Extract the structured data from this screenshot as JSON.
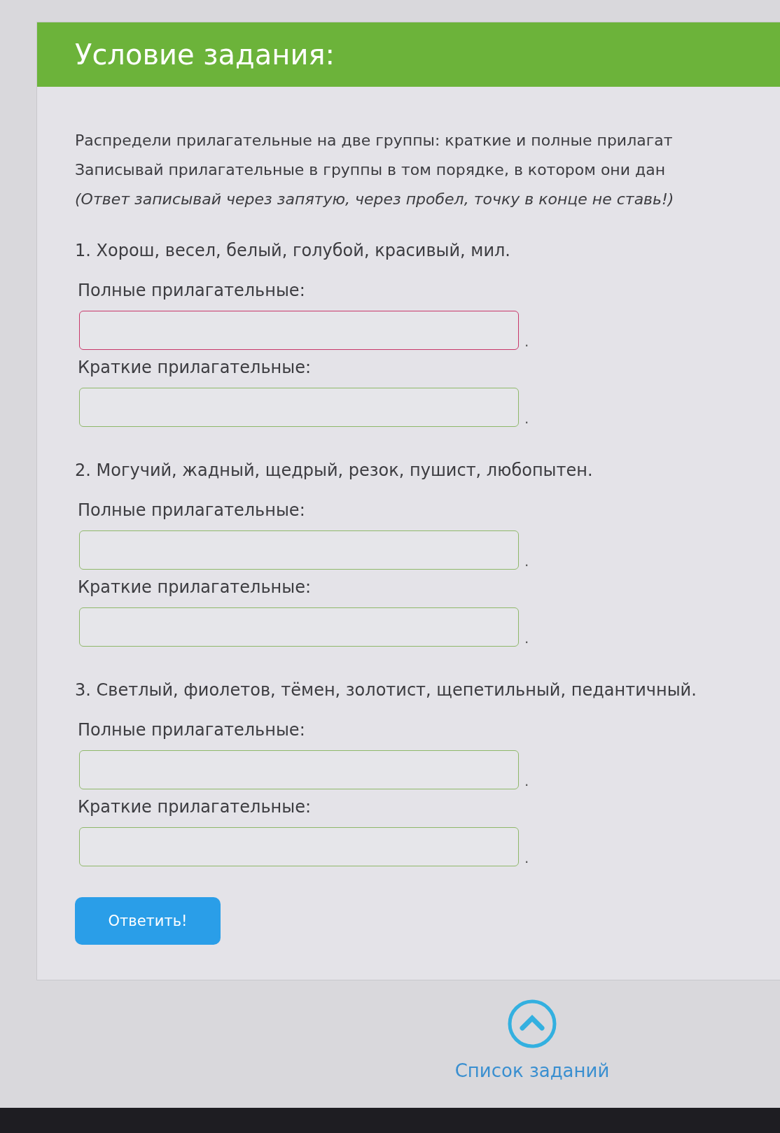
{
  "header": {
    "title": "Условие задания:"
  },
  "instructions": [
    {
      "text": "Распредели прилагательные на две группы: краткие и полные прилагат",
      "italic": false
    },
    {
      "text": "Записывай прилагательные в группы в том порядке, в котором они дан",
      "italic": false
    },
    {
      "text": "(Ответ записывай через запятую, через пробел, точку в конце не ставь!)",
      "italic": true
    }
  ],
  "tasks": [
    {
      "prompt": "1. Хорош, весел, белый, голубой, красивый, мил.",
      "fields": [
        {
          "label": "Полные прилагательные:",
          "focused": true,
          "suffix": "."
        },
        {
          "label": "Краткие прилагательные:",
          "focused": false,
          "suffix": "."
        }
      ]
    },
    {
      "prompt": "2. Могучий, жадный, щедрый, резок, пушист, любопытен.",
      "fields": [
        {
          "label": "Полные прилагательные:",
          "focused": false,
          "suffix": "."
        },
        {
          "label": "Краткие прилагательные:",
          "focused": false,
          "suffix": "."
        }
      ]
    },
    {
      "prompt": "3. Светлый, фиолетов, тёмен, золотист, щепетильный, педантичный.",
      "fields": [
        {
          "label": "Полные прилагательные:",
          "focused": false,
          "suffix": "."
        },
        {
          "label": "Краткие прилагательные:",
          "focused": false,
          "suffix": "."
        }
      ]
    }
  ],
  "submit_button": "Ответить!",
  "task_list_link": "Список заданий"
}
